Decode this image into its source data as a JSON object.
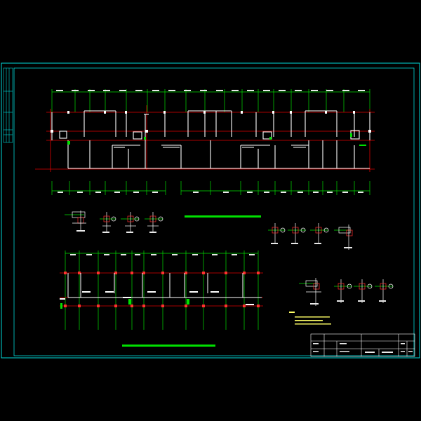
{
  "drawing": {
    "colors": {
      "background": "#000000",
      "frame": "#00d8d8",
      "walls": "#ffffff",
      "axes": "#e00000",
      "dims": "#00e000",
      "highlight": "#00e000",
      "detail_red": "#ff3030"
    },
    "title_block": {
      "row1": "",
      "row2": ""
    }
  },
  "plan_main": {
    "description_visible": false
  },
  "notes": {
    "heading": "",
    "lines": [
      "",
      "",
      ""
    ]
  }
}
